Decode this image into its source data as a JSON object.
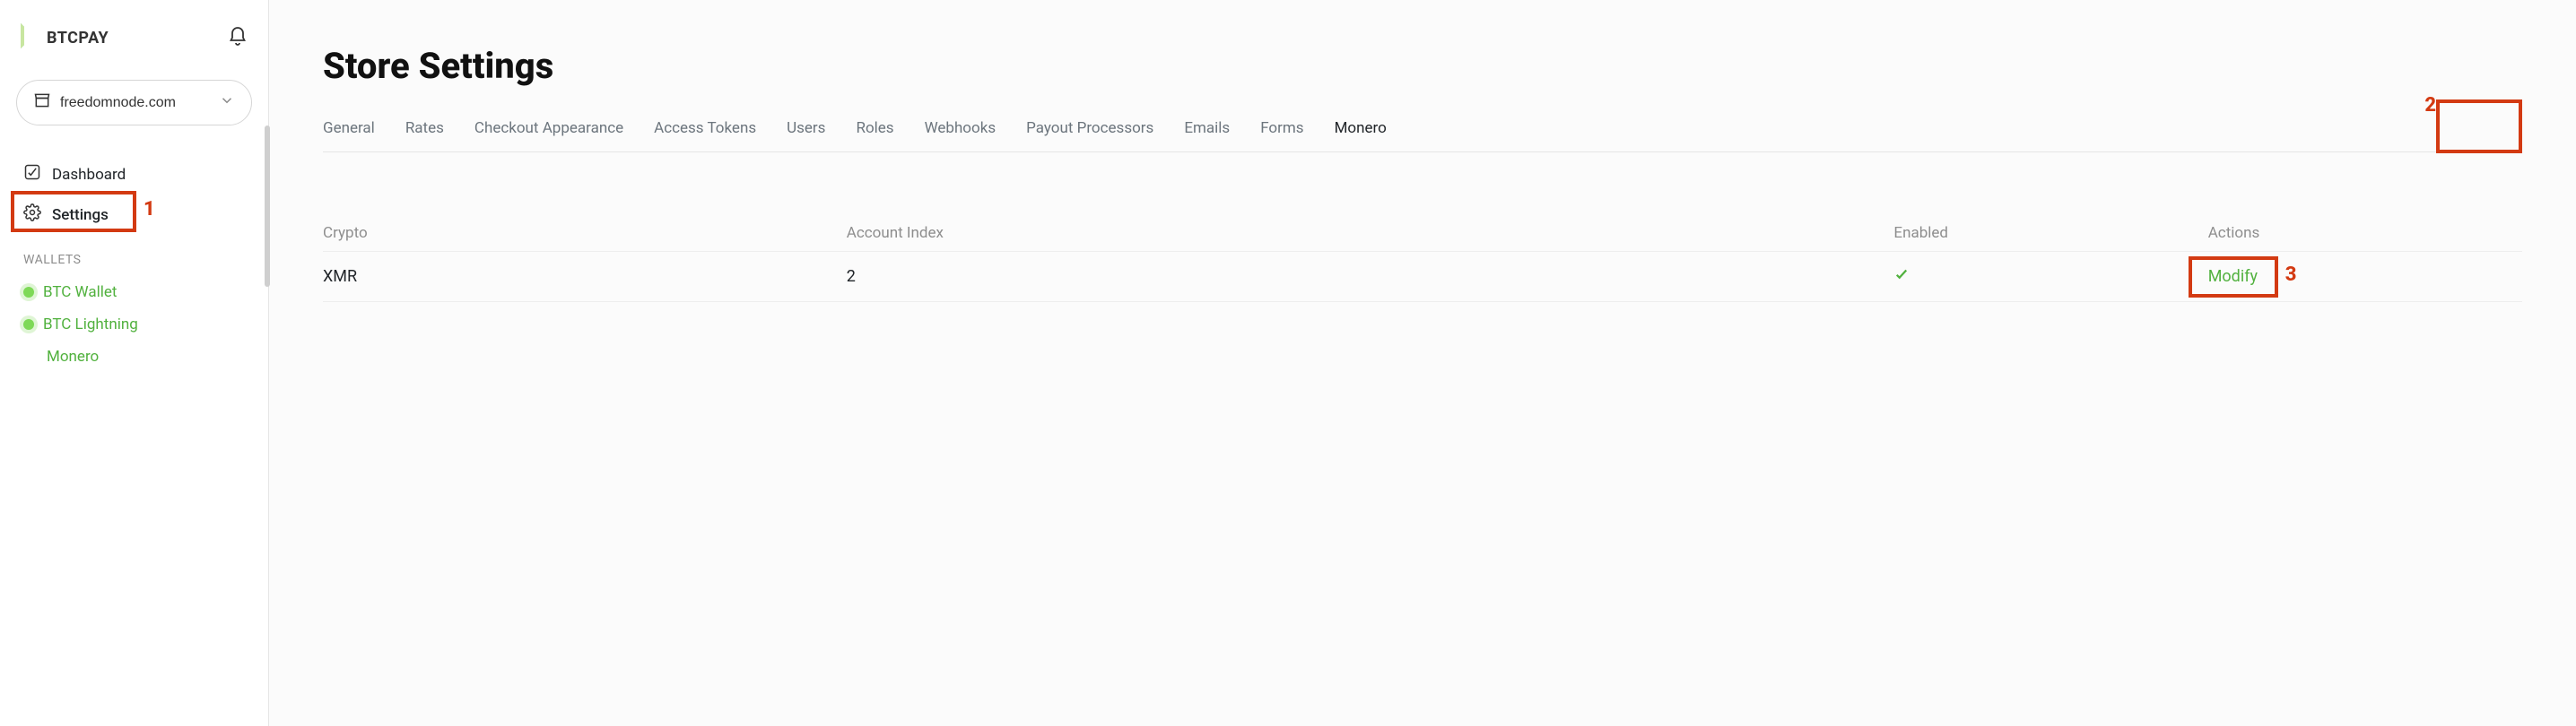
{
  "brand": {
    "name": "BTCPAY"
  },
  "store": {
    "name": "freedomnode.com"
  },
  "nav": {
    "dashboard": "Dashboard",
    "settings": "Settings",
    "walletsLabel": "WALLETS",
    "btcWallet": "BTC Wallet",
    "btcLightning": "BTC Lightning",
    "monero": "Monero"
  },
  "page": {
    "title": "Store Settings"
  },
  "tabs": {
    "general": "General",
    "rates": "Rates",
    "checkout": "Checkout Appearance",
    "tokens": "Access Tokens",
    "users": "Users",
    "roles": "Roles",
    "webhooks": "Webhooks",
    "payout": "Payout Processors",
    "emails": "Emails",
    "forms": "Forms",
    "monero": "Monero"
  },
  "table": {
    "head": {
      "crypto": "Crypto",
      "accountIndex": "Account Index",
      "enabled": "Enabled",
      "actions": "Actions"
    },
    "rows": [
      {
        "crypto": "XMR",
        "accountIndex": "2",
        "enabled": true,
        "action": "Modify"
      }
    ]
  },
  "annotations": {
    "one": "1",
    "two": "2",
    "three": "3"
  }
}
